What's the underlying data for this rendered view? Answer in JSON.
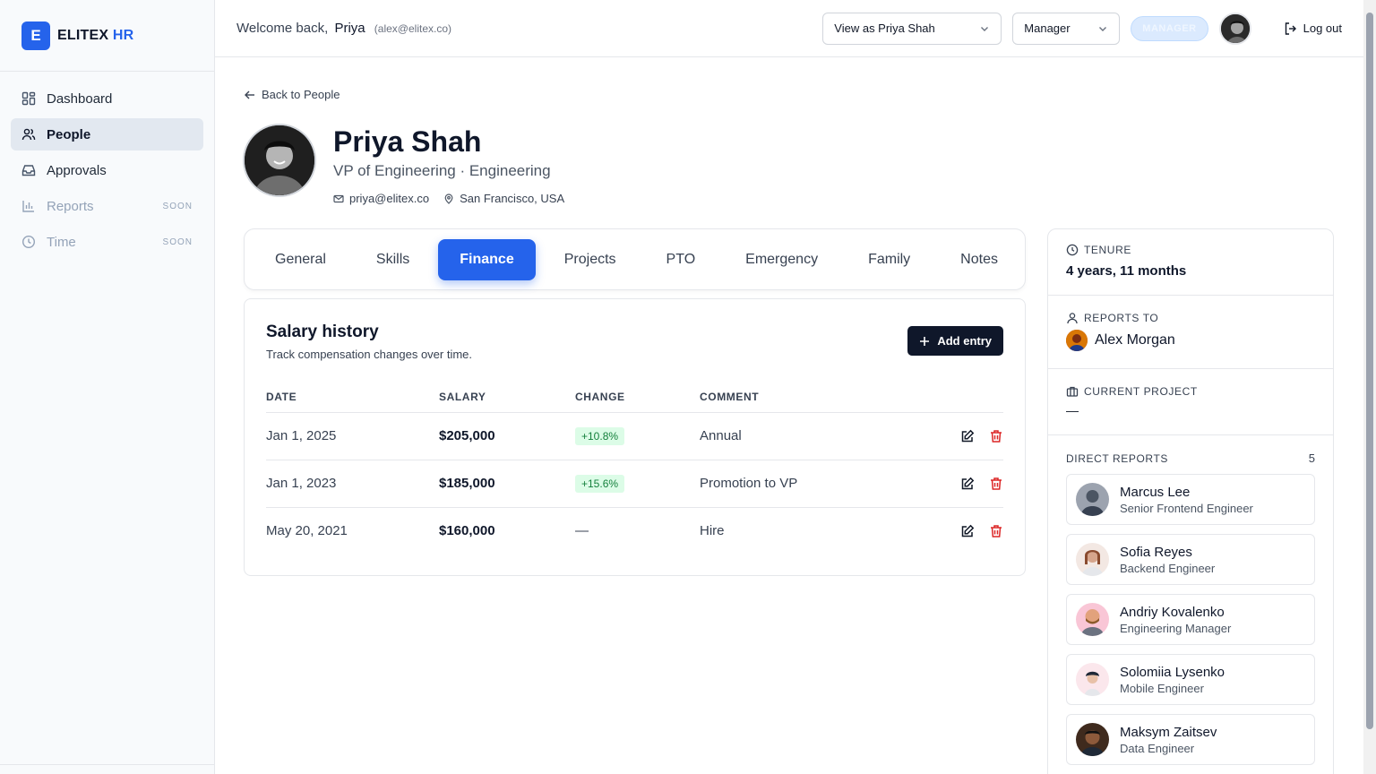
{
  "brand": {
    "logo_letter": "E",
    "name_part1": "ELITEX",
    "name_part2": "HR",
    "accent": "#2563eb"
  },
  "sidebar": {
    "items": [
      {
        "label": "Dashboard",
        "icon": "dashboard-icon"
      },
      {
        "label": "People",
        "icon": "people-icon",
        "active": true
      },
      {
        "label": "Approvals",
        "icon": "inbox-icon"
      },
      {
        "label": "Reports",
        "icon": "bar-chart-icon",
        "badge": "SOON",
        "disabled": true
      },
      {
        "label": "Time",
        "icon": "clock-icon",
        "badge": "SOON",
        "disabled": true
      }
    ]
  },
  "header": {
    "welcome_prefix": "Welcome back,",
    "user_name": "Priya",
    "user_email": "(alex@elitex.co)",
    "view_as_select": "View as Priya Shah",
    "role_select": "Manager",
    "role_badge": "MANAGER",
    "logout_label": "Log out"
  },
  "profile": {
    "back_label": "Back to People",
    "name": "Priya Shah",
    "title": "VP of Engineering · Engineering",
    "email": "priya@elitex.co",
    "location": "San Francisco, USA"
  },
  "tabs": [
    {
      "label": "General"
    },
    {
      "label": "Skills"
    },
    {
      "label": "Finance",
      "active": true
    },
    {
      "label": "Projects"
    },
    {
      "label": "PTO"
    },
    {
      "label": "Emergency"
    },
    {
      "label": "Family"
    },
    {
      "label": "Notes"
    }
  ],
  "salary": {
    "title": "Salary history",
    "subtitle": "Track compensation changes over time.",
    "add_label": "Add entry",
    "columns": [
      "DATE",
      "SALARY",
      "CHANGE",
      "COMMENT"
    ],
    "rows": [
      {
        "date": "Jan 1, 2025",
        "salary": "$205,000",
        "change": "+10.8%",
        "comment": "Annual"
      },
      {
        "date": "Jan 1, 2023",
        "salary": "$185,000",
        "change": "+15.6%",
        "comment": "Promotion to VP"
      },
      {
        "date": "May 20, 2021",
        "salary": "$160,000",
        "change": "—",
        "comment": "Hire"
      }
    ]
  },
  "side": {
    "tenure_label": "TENURE",
    "tenure_value": "4 years, 11 months",
    "reports_to_label": "REPORTS TO",
    "reports_to_name": "Alex Morgan",
    "project_label": "CURRENT PROJECT",
    "project_value": "—",
    "direct_reports_label": "DIRECT REPORTS",
    "direct_reports_count": "5",
    "direct_reports": [
      {
        "name": "Marcus Lee",
        "title": "Senior Frontend Engineer"
      },
      {
        "name": "Sofia Reyes",
        "title": "Backend Engineer"
      },
      {
        "name": "Andriy Kovalenko",
        "title": "Engineering Manager"
      },
      {
        "name": "Solomiia Lysenko",
        "title": "Mobile Engineer"
      },
      {
        "name": "Maksym Zaitsev",
        "title": "Data Engineer"
      }
    ]
  }
}
